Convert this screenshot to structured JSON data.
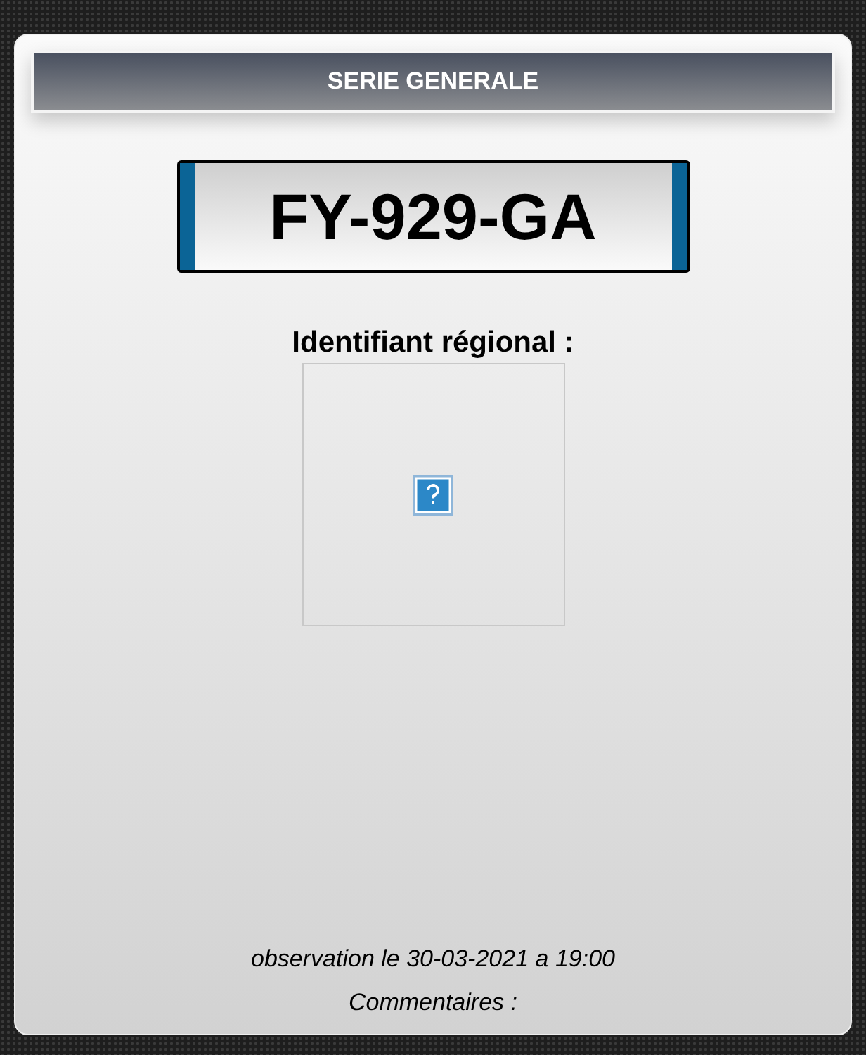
{
  "header": {
    "title": "SERIE GENERALE"
  },
  "plate": {
    "number": "FY-929-GA"
  },
  "regional_identifier": {
    "label": "Identifiant régional :",
    "image": {
      "broken": true
    }
  },
  "observation": "observation le 30-03-2021 a 19:00",
  "comments_label": "Commentaires :"
}
